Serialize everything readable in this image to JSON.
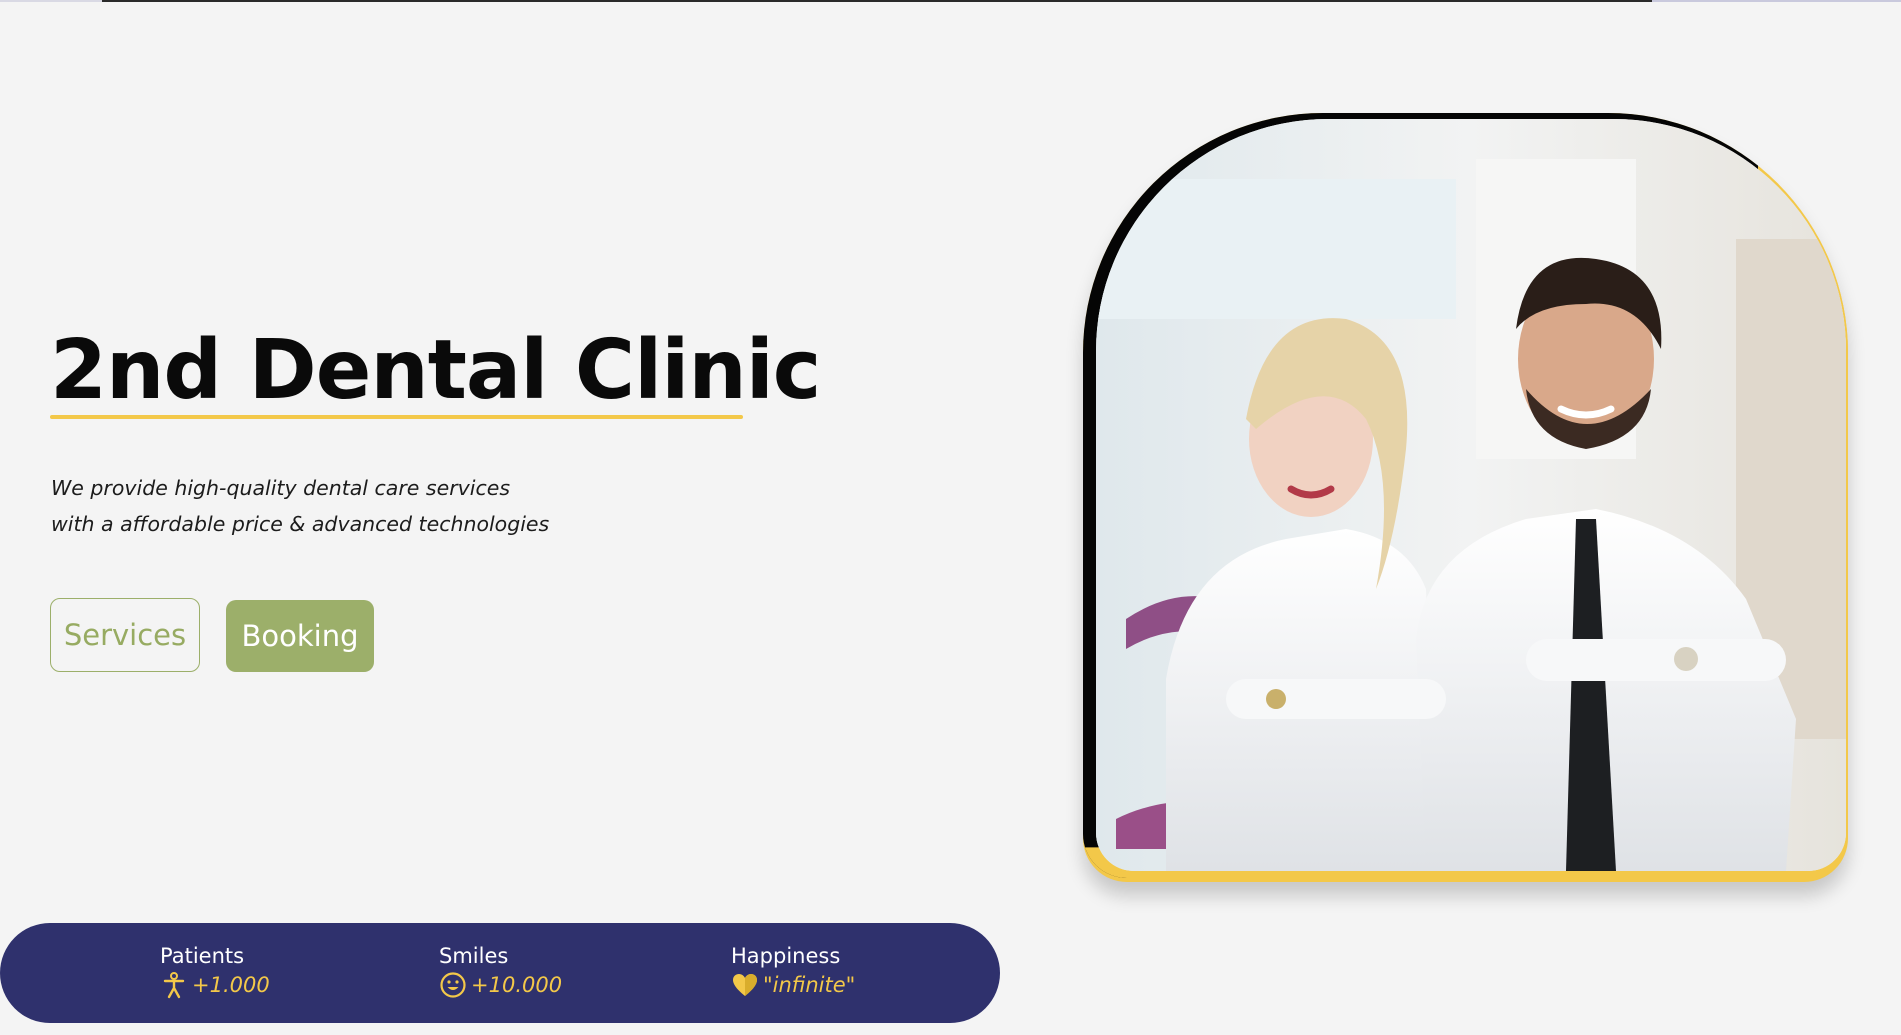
{
  "hero": {
    "title": "2nd Dental Clinic",
    "subtitle_line1": "We provide high-quality dental care services",
    "subtitle_line2": "with a affordable price & advanced technologies",
    "services_label": "Services",
    "booking_label": "Booking"
  },
  "stats": [
    {
      "label": "Patients",
      "value": "+1.000",
      "icon": "accessibility-person-icon"
    },
    {
      "label": "Smiles",
      "value": "+10.000",
      "icon": "smiley-face-icon"
    },
    {
      "label": "Happiness",
      "value": "\"infinite\"",
      "icon": "heart-icon"
    }
  ],
  "colors": {
    "accent_yellow": "#f3c849",
    "button_green": "#9caf6a",
    "stats_navy": "#2f316d",
    "background": "#f4f4f4"
  }
}
